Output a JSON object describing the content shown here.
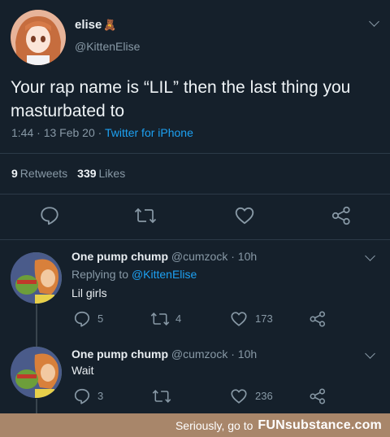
{
  "main_tweet": {
    "display_name": "elise",
    "display_emoji": "🧸",
    "handle": "@KittenElise",
    "text": "Your rap name is “LIL” then the last thing you masturbated to",
    "time": "1:44 · 13 Feb 20 · ",
    "source": "Twitter for iPhone",
    "retweets_count": "9",
    "retweets_label": "Retweets",
    "likes_count": "339",
    "likes_label": "Likes"
  },
  "replies": [
    {
      "display_name": "One pump chump",
      "handle_time": "@cumzock · 10h",
      "replying_prefix": "Replying to ",
      "replying_handle": "@KittenElise",
      "text": "Lil girls",
      "reply_count": "5",
      "retweet_count": "4",
      "like_count": "173"
    },
    {
      "display_name": "One pump chump",
      "handle_time": "@cumzock · 10h",
      "text": "Wait",
      "reply_count": "3",
      "retweet_count": "",
      "like_count": "236"
    }
  ],
  "footer": {
    "text": "Seriously, go to",
    "brand": "FUNsubstance.com"
  },
  "colors": {
    "background": "#15202b",
    "accent": "#1da1f2",
    "muted": "#8899a6",
    "footer_bg": "#a8866a"
  }
}
